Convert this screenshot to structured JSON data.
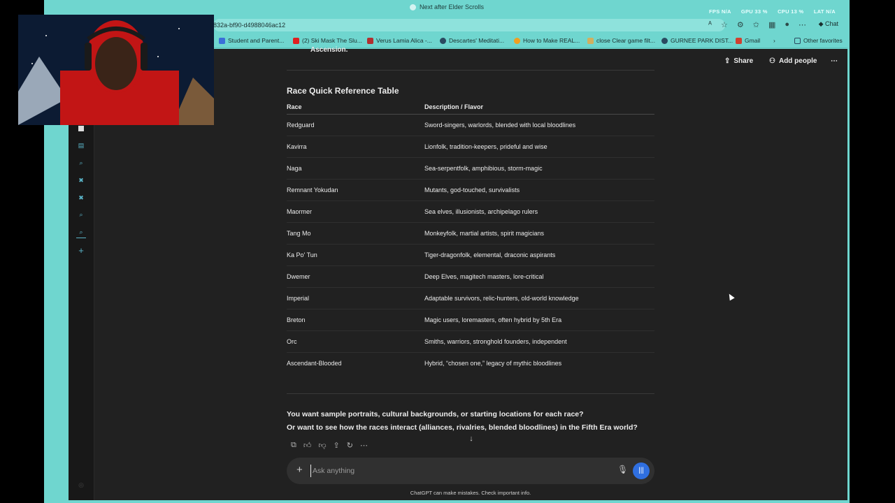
{
  "window": {
    "title": "Next after Elder Scrolls",
    "stats": [
      "FPS N/A",
      "GPU 33 %",
      "CPU 13 %",
      "LAT N/A"
    ]
  },
  "addressbar": {
    "url": "832a-bf90-d4988046ac12",
    "chat_label": "Chat"
  },
  "bookmarks": [
    {
      "label": "Student and Parent...",
      "color": "#3a6fd8"
    },
    {
      "label": "(2) Ski Mask The Slu...",
      "color": "#e02020"
    },
    {
      "label": "Verus Lamia Alica -...",
      "color": "#b03030"
    },
    {
      "label": "Descartes' Meditati...",
      "color": "#2a4a60"
    },
    {
      "label": "How to Make REAL...",
      "color": "#f0a020"
    },
    {
      "label": "close Clear game filt...",
      "color": "#d0b060"
    },
    {
      "label": "GURNEE PARK DIST...",
      "color": "#2a4a60"
    },
    {
      "label": "Gmail",
      "color": "#d04030"
    },
    {
      "label": "Other favorites",
      "color": "#2a4a60"
    }
  ],
  "header": {
    "share_label": "Share",
    "add_people_label": "Add people"
  },
  "conversation": {
    "prev_text": "Ascension.",
    "table_title": "Race Quick Reference Table",
    "columns": [
      "Race",
      "Description / Flavor"
    ],
    "rows": [
      {
        "race": "Redguard",
        "desc": "Sword-singers, warlords, blended with local bloodlines"
      },
      {
        "race": "Kavirra",
        "desc": "Lionfolk, tradition-keepers, prideful and wise"
      },
      {
        "race": "Naga",
        "desc": "Sea-serpentfolk, amphibious, storm-magic"
      },
      {
        "race": "Remnant Yokudan",
        "desc": "Mutants, god-touched, survivalists"
      },
      {
        "race": "Maormer",
        "desc": "Sea elves, illusionists, archipelago rulers"
      },
      {
        "race": "Tang Mo",
        "desc": "Monkeyfolk, martial artists, spirit magicians"
      },
      {
        "race": "Ka Po' Tun",
        "desc": "Tiger-dragonfolk, elemental, draconic aspirants"
      },
      {
        "race": "Dwemer",
        "desc": "Deep Elves, magitech masters, lore-critical"
      },
      {
        "race": "Imperial",
        "desc": "Adaptable survivors, relic-hunters, old-world knowledge"
      },
      {
        "race": "Breton",
        "desc": "Magic users, loremasters, often hybrid by 5th Era"
      },
      {
        "race": "Orc",
        "desc": "Smiths, warriors, stronghold founders, independent"
      },
      {
        "race": "Ascendant-Blooded",
        "desc": "Hybrid, “chosen one,” legacy of mythic bloodlines"
      }
    ],
    "question1": "You want sample portraits, cultural backgrounds, or starting locations for each race?",
    "question2": "Or want to see how the races interact (alliances, rivalries, blended bloodlines) in the Fifth Era world?"
  },
  "composer": {
    "placeholder": "Ask anything"
  },
  "disclaimer": "ChatGPT can make mistakes. Check important info."
}
